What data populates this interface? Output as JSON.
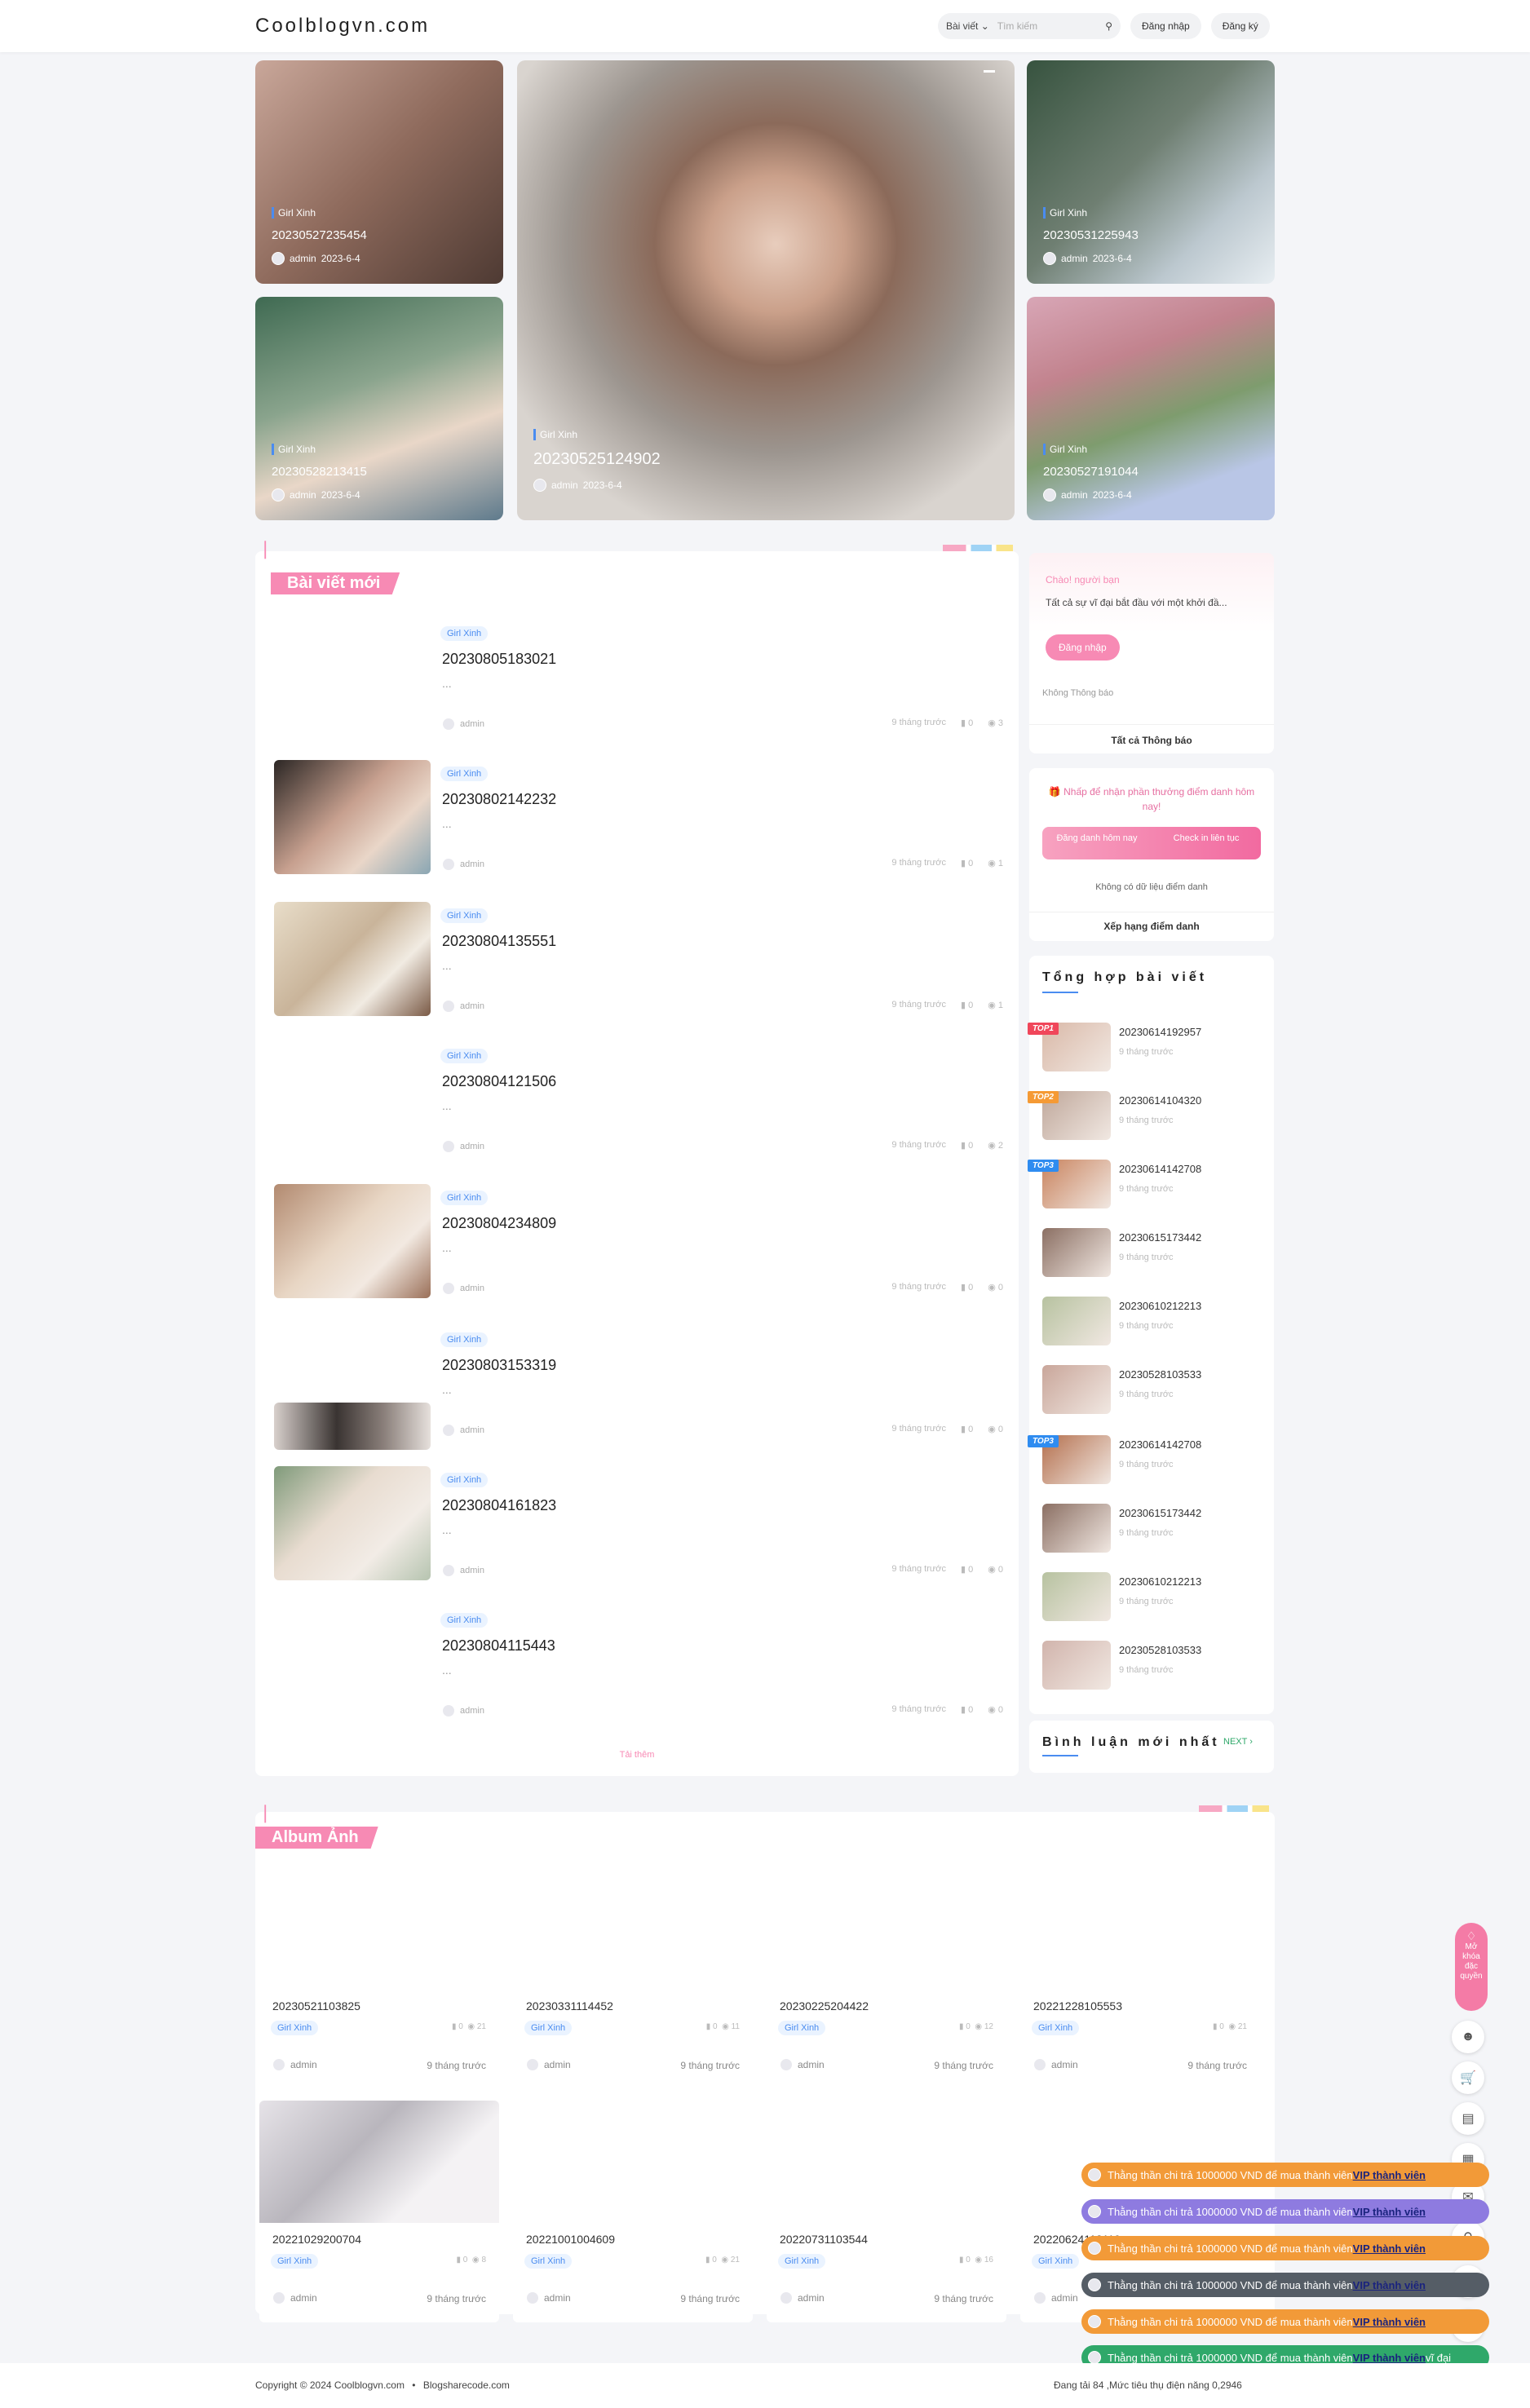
{
  "header": {
    "logo": "Coolblogvn.com",
    "category": "Bài viết",
    "search_placeholder": "Tìm kiếm",
    "login": "Đăng nhập",
    "register": "Đăng ký"
  },
  "hero": [
    {
      "cat": "Girl Xinh",
      "title": "20230527235454",
      "author": "admin",
      "date": "2023-6-4"
    },
    {
      "cat": "Girl Xinh",
      "title": "20230525124902",
      "author": "admin",
      "date": "2023-6-4"
    },
    {
      "cat": "Girl Xinh",
      "title": "20230531225943",
      "author": "admin",
      "date": "2023-6-4"
    },
    {
      "cat": "Girl Xinh",
      "title": "20230528213415",
      "author": "admin",
      "date": "2023-6-4"
    },
    {
      "cat": "Girl Xinh",
      "title": "20230527191044",
      "author": "admin",
      "date": "2023-6-4"
    }
  ],
  "latest": {
    "title": "Bài viết mới",
    "load_more": "Tải thêm",
    "posts": [
      {
        "tag": "Girl Xinh",
        "title": "20230805183021",
        "excerpt": "...",
        "author": "admin",
        "time": "9 tháng trước",
        "comments": "0",
        "views": "3"
      },
      {
        "tag": "Girl Xinh",
        "title": "20230802142232",
        "excerpt": "...",
        "author": "admin",
        "time": "9 tháng trước",
        "comments": "0",
        "views": "1"
      },
      {
        "tag": "Girl Xinh",
        "title": "20230804135551",
        "excerpt": "...",
        "author": "admin",
        "time": "9 tháng trước",
        "comments": "0",
        "views": "1"
      },
      {
        "tag": "Girl Xinh",
        "title": "20230804121506",
        "excerpt": "...",
        "author": "admin",
        "time": "9 tháng trước",
        "comments": "0",
        "views": "2"
      },
      {
        "tag": "Girl Xinh",
        "title": "20230804234809",
        "excerpt": "...",
        "author": "admin",
        "time": "9 tháng trước",
        "comments": "0",
        "views": "0"
      },
      {
        "tag": "Girl Xinh",
        "title": "20230803153319",
        "excerpt": "...",
        "author": "admin",
        "time": "9 tháng trước",
        "comments": "0",
        "views": "0"
      },
      {
        "tag": "Girl Xinh",
        "title": "20230804161823",
        "excerpt": "...",
        "author": "admin",
        "time": "9 tháng trước",
        "comments": "0",
        "views": "0"
      },
      {
        "tag": "Girl Xinh",
        "title": "20230804115443",
        "excerpt": "...",
        "author": "admin",
        "time": "9 tháng trước",
        "comments": "0",
        "views": "0"
      }
    ]
  },
  "sidebar": {
    "greet": "Chào! người bạn",
    "greet_sub": "Tất cả sự vĩ đại bắt đầu với một khởi đầ...",
    "login_btn": "Đăng nhập",
    "no_notif": "Không Thông báo",
    "all_notif": "Tất cả Thông báo",
    "checkin_title": "Nhấp để nhận phần thưởng điểm danh hôm nay!",
    "checkin_btn": "Đăng danh hôm nay",
    "checkin_btn2": "Check in liên tục",
    "no_checkin": "Không có dữ liệu điểm danh",
    "rank_link": "Xếp hạng điểm danh",
    "hot_title": "Tổng hợp bài viết",
    "comments_title": "Bình luận mới nhất",
    "next": "NEXT",
    "hot": [
      {
        "rank": "TOP1",
        "title": "20230614192957",
        "time": "9 tháng trước"
      },
      {
        "rank": "TOP2",
        "title": "20230614104320",
        "time": "9 tháng trước"
      },
      {
        "rank": "TOP3",
        "title": "20230614142708",
        "time": "9 tháng trước"
      },
      {
        "rank": "",
        "title": "20230615173442",
        "time": "9 tháng trước"
      },
      {
        "rank": "",
        "title": "20230610212213",
        "time": "9 tháng trước"
      },
      {
        "rank": "",
        "title": "20230528103533",
        "time": "9 tháng trước"
      },
      {
        "rank": "TOP3",
        "title": "20230614142708",
        "time": "9 tháng trước"
      },
      {
        "rank": "",
        "title": "20230615173442",
        "time": "9 tháng trước"
      },
      {
        "rank": "",
        "title": "20230610212213",
        "time": "9 tháng trước"
      },
      {
        "rank": "",
        "title": "20230528103533",
        "time": "9 tháng trước"
      }
    ]
  },
  "album": {
    "title": "Album Ảnh",
    "items": [
      {
        "title": "20230521103825",
        "tag": "Girl Xinh",
        "comments": "0",
        "views": "21",
        "author": "admin",
        "time": "9 tháng trước"
      },
      {
        "title": "20230331114452",
        "tag": "Girl Xinh",
        "comments": "0",
        "views": "11",
        "author": "admin",
        "time": "9 tháng trước"
      },
      {
        "title": "20230225204422",
        "tag": "Girl Xinh",
        "comments": "0",
        "views": "12",
        "author": "admin",
        "time": "9 tháng trước"
      },
      {
        "title": "20221228105553",
        "tag": "Girl Xinh",
        "comments": "0",
        "views": "21",
        "author": "admin",
        "time": "9 tháng trước"
      },
      {
        "title": "20221029200704",
        "tag": "Girl Xinh",
        "comments": "0",
        "views": "8",
        "author": "admin",
        "time": "9 tháng trước"
      },
      {
        "title": "20221001004609",
        "tag": "Girl Xinh",
        "comments": "0",
        "views": "21",
        "author": "admin",
        "time": "9 tháng trước"
      },
      {
        "title": "20220731103544",
        "tag": "Girl Xinh",
        "comments": "0",
        "views": "16",
        "author": "admin",
        "time": "9 tháng trước"
      },
      {
        "title": "20220624112119",
        "tag": "Girl Xinh",
        "comments": "",
        "views": "",
        "author": "admin",
        "time": ""
      }
    ]
  },
  "vip_badge": "Mở khóa đặc quyền",
  "notifications": [
    {
      "text": "Thằng thần chi trả 1000000 VND để mua thành viên",
      "vip": "VIP thành viên",
      "color": "#f29a38"
    },
    {
      "text": "Thằng thần chi trả 1000000 VND để mua thành viên",
      "vip": "VIP thành viên",
      "color": "#8e7be0"
    },
    {
      "text": "Thằng thần chi trả 1000000 VND để mua thành viên",
      "vip": "VIP thành viên",
      "color": "#f29a38"
    },
    {
      "text": "Thằng thần chi trả 1000000 VND để mua thành viên",
      "vip": "VIP thành viên",
      "color": "#555d66"
    },
    {
      "text": "Thằng thần chi trả 1000000 VND để mua thành viên",
      "vip": "VIP thành viên",
      "color": "#f29a38"
    },
    {
      "text": "Thằng thần chi trả 1000000 VND để mua thành viên",
      "vip": "VIP thành viên",
      "color": "#2fa86a",
      "suffix": "vĩ đại"
    }
  ],
  "footer": {
    "copyright": "Copyright © 2024 Coolblogvn.com",
    "sep": "•",
    "link": "Blogsharecode.com",
    "stats": "Đang tải 84 ,Mức tiêu thụ điện năng 0,2946"
  }
}
